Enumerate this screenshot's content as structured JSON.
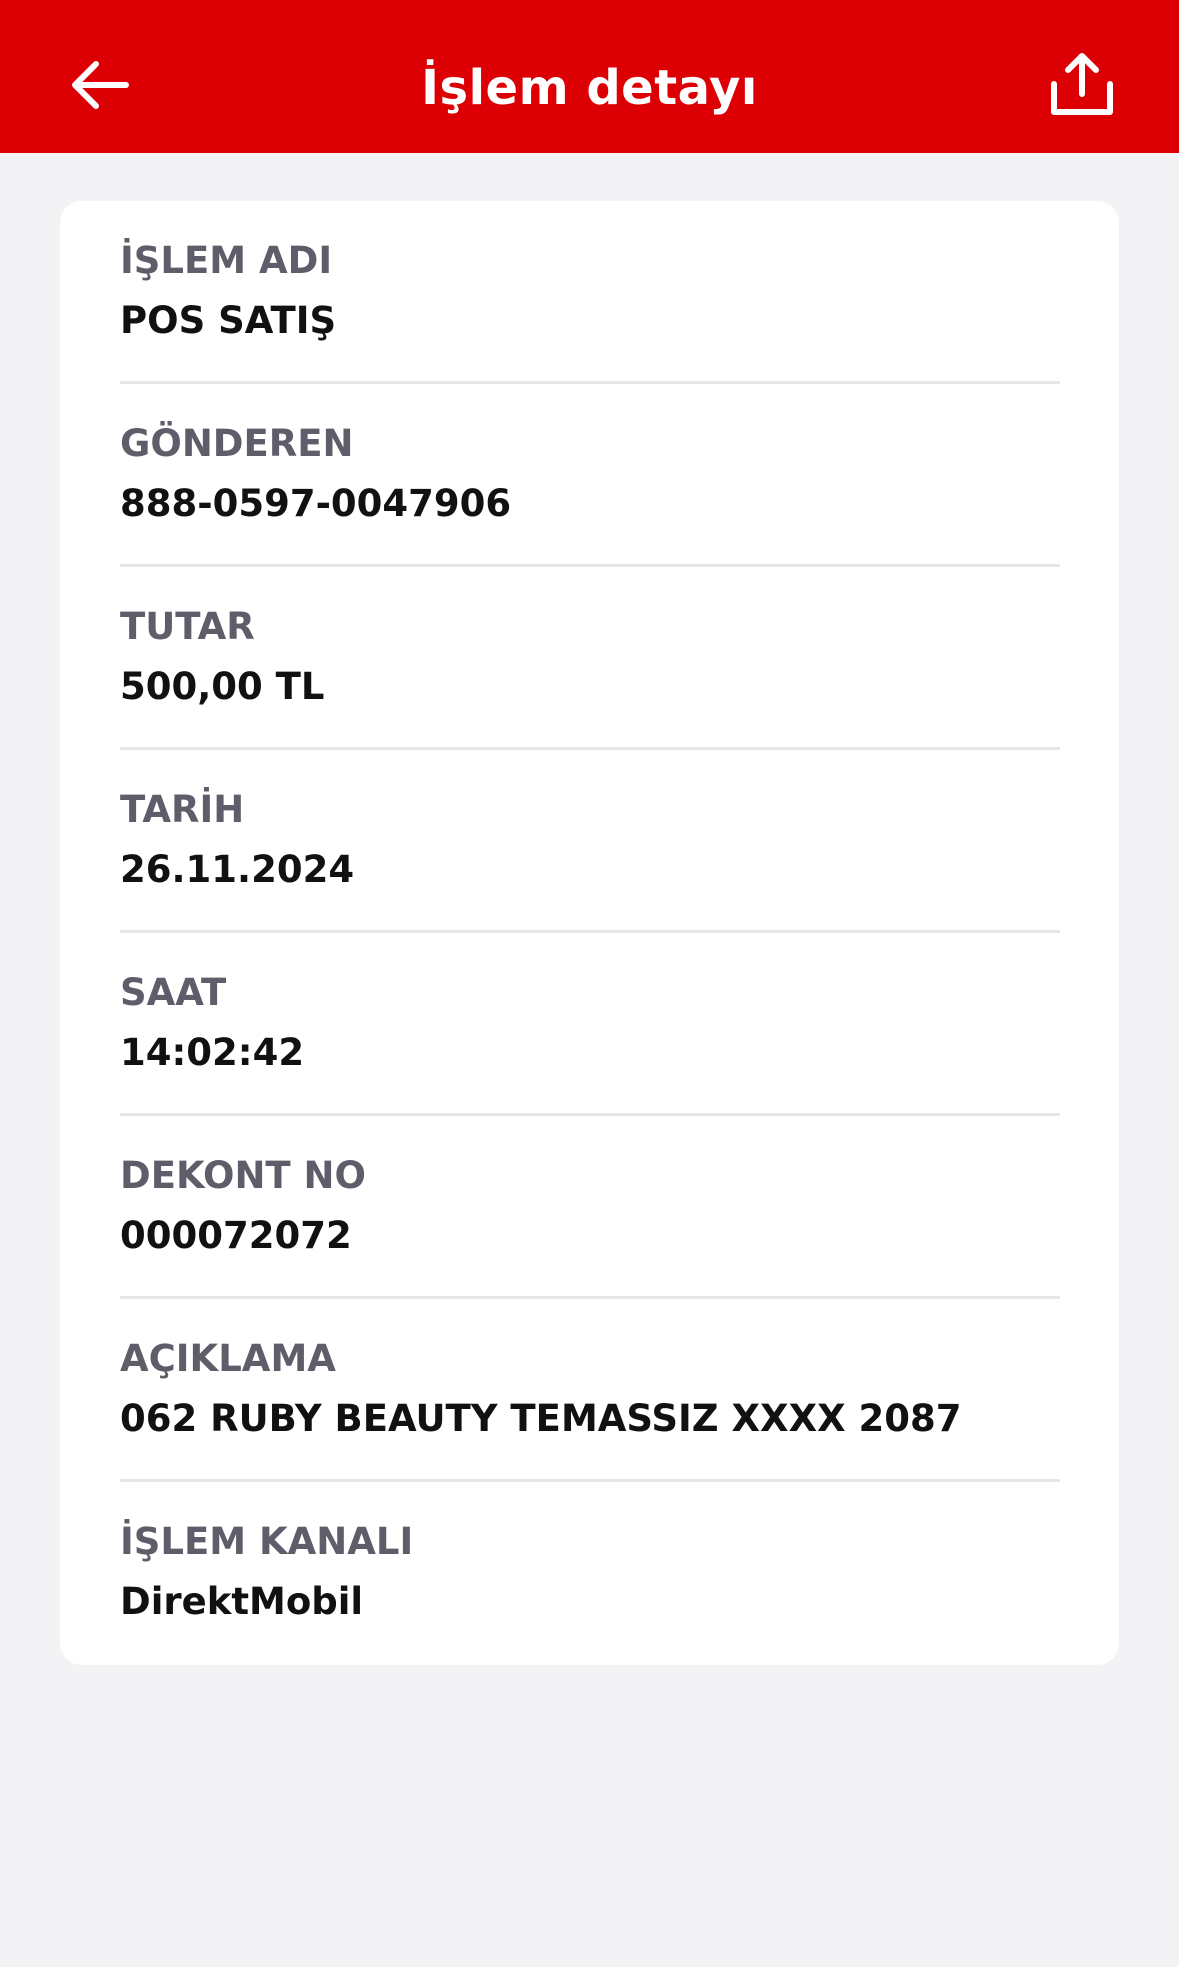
{
  "header": {
    "title": "İşlem detayı",
    "back_icon": "arrow-left-icon",
    "share_icon": "share-upload-icon",
    "background_color": "#dc0005"
  },
  "details": [
    {
      "label": "İŞLEM ADI",
      "value": "POS SATIŞ"
    },
    {
      "label": "GÖNDEREN",
      "value": "888-0597-0047906"
    },
    {
      "label": "TUTAR",
      "value": "500,00 TL"
    },
    {
      "label": "TARİH",
      "value": "26.11.2024"
    },
    {
      "label": "SAAT",
      "value": "14:02:42"
    },
    {
      "label": "DEKONT NO",
      "value": "000072072"
    },
    {
      "label": "AÇIKLAMA",
      "value": "062 RUBY BEAUTY TEMASSIZ XXXX 2087"
    },
    {
      "label": "İŞLEM KANALI",
      "value": "DirektMobil"
    }
  ]
}
